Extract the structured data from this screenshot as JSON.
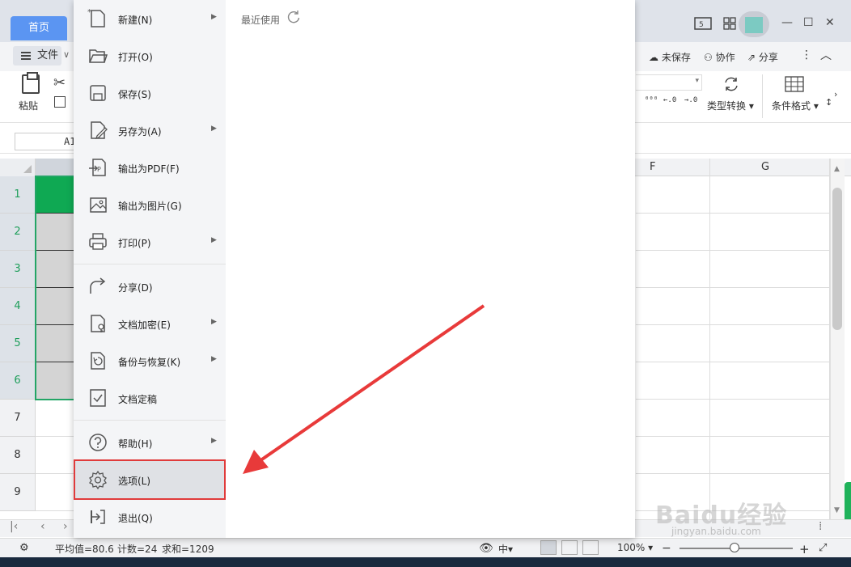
{
  "window": {
    "home_tab": "首页",
    "file_button": "文件",
    "unsaved": "未保存",
    "collaborate": "协作",
    "share": "分享"
  },
  "ribbon": {
    "paste": "粘贴",
    "type_convert": "类型转换",
    "conditional_format": "条件格式",
    "num_increase": "⁰⁰⁰",
    "num_left": "←.0",
    "num_right": "→.0"
  },
  "formula_bar": {
    "cell_ref": "A1"
  },
  "grid": {
    "columns": [
      "F",
      "G"
    ],
    "rows": [
      "1",
      "2",
      "3",
      "4",
      "5",
      "6",
      "7",
      "8",
      "9"
    ]
  },
  "file_menu": {
    "items": [
      {
        "label": "新建(N)",
        "icon": "new-file-icon",
        "submenu": true
      },
      {
        "label": "打开(O)",
        "icon": "folder-open-icon",
        "submenu": false
      },
      {
        "label": "保存(S)",
        "icon": "save-icon",
        "submenu": false
      },
      {
        "label": "另存为(A)",
        "icon": "save-as-icon",
        "submenu": true
      },
      {
        "label": "输出为PDF(F)",
        "icon": "pdf-icon",
        "submenu": false
      },
      {
        "label": "输出为图片(G)",
        "icon": "image-icon",
        "submenu": false
      },
      {
        "label": "打印(P)",
        "icon": "print-icon",
        "submenu": true
      },
      {
        "label": "分享(D)",
        "icon": "share-icon",
        "submenu": false
      },
      {
        "label": "文档加密(E)",
        "icon": "encrypt-icon",
        "submenu": true
      },
      {
        "label": "备份与恢复(K)",
        "icon": "backup-icon",
        "submenu": true
      },
      {
        "label": "文档定稿",
        "icon": "finalize-icon",
        "submenu": false
      },
      {
        "label": "帮助(H)",
        "icon": "help-icon",
        "submenu": true
      },
      {
        "label": "选项(L)",
        "icon": "gear-icon",
        "submenu": false,
        "highlighted": true
      },
      {
        "label": "退出(Q)",
        "icon": "exit-icon",
        "submenu": false
      }
    ],
    "recent_label": "最近使用"
  },
  "status": {
    "average": "平均值=80.6",
    "count": "计数=24",
    "sum": "求和=1209",
    "zoom": "100%"
  },
  "watermark": {
    "logo": "Baidu经验",
    "url": "jingyan.baidu.com"
  },
  "colors": {
    "accent_blue": "#5b95f2",
    "selection_green": "#0fa953",
    "highlight_red": "#e03b3b"
  }
}
